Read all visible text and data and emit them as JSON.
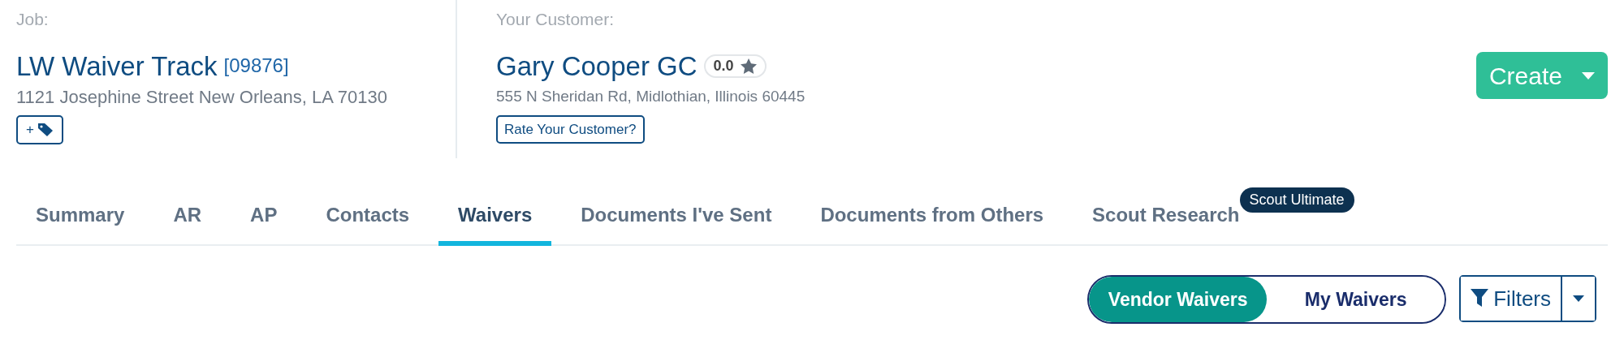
{
  "job": {
    "label": "Job:",
    "title": "LW Waiver Track",
    "number": "[09876]",
    "address": "1121 Josephine Street New Orleans, LA 70130",
    "tag_button": "+"
  },
  "customer": {
    "label": "Your Customer:",
    "name": "Gary Cooper GC",
    "rating": "0.0",
    "address": "555 N Sheridan Rd, Midlothian, Illinois 60445",
    "rate_button": "Rate Your Customer?"
  },
  "create_button": "Create",
  "tabs": [
    {
      "label": "Summary",
      "selected": false
    },
    {
      "label": "AR",
      "selected": false
    },
    {
      "label": "AP",
      "selected": false
    },
    {
      "label": "Contacts",
      "selected": false
    },
    {
      "label": "Waivers",
      "selected": true
    },
    {
      "label": "Documents I've Sent",
      "selected": false
    },
    {
      "label": "Documents from Others",
      "selected": false
    },
    {
      "label": "Scout Research",
      "selected": false,
      "badge": "Scout Ultimate"
    }
  ],
  "waiver_toggle": [
    {
      "label": "Vendor Waivers",
      "selected": true
    },
    {
      "label": "My Waivers",
      "selected": false
    }
  ],
  "filters_button": "Filters"
}
